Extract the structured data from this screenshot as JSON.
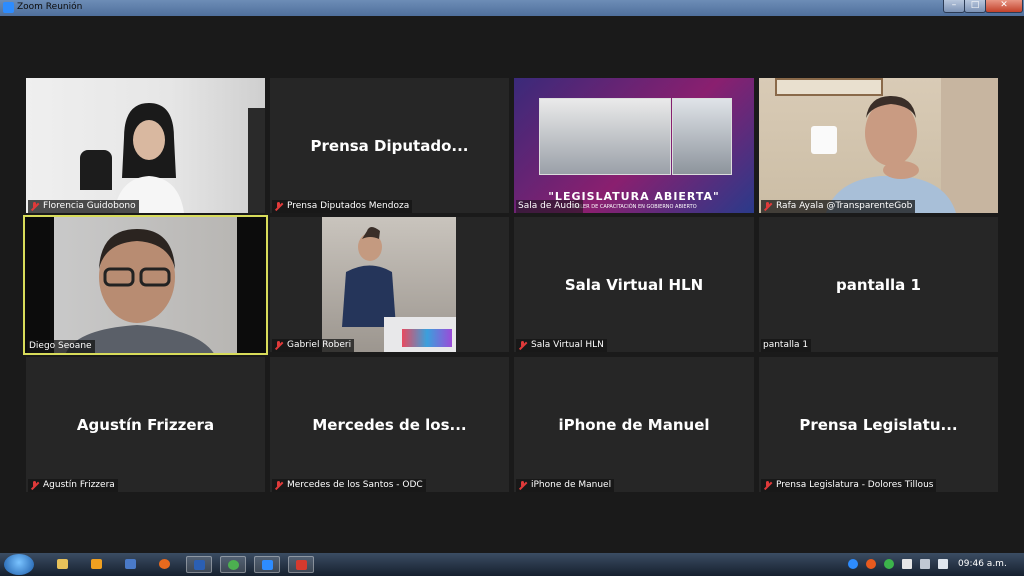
{
  "window": {
    "title": "Zoom Reunión"
  },
  "tiles": [
    {
      "name": "Florencia Guidobono",
      "big": ""
    },
    {
      "name": "Prensa Diputados Mendoza",
      "big": "Prensa Diputado..."
    },
    {
      "name": "Sala de Audio",
      "big": "",
      "banner": "\"LEGISLATURA ABIERTA\"",
      "banner_sub": "TALLER DE CAPACITACIÓN EN GOBIERNO ABIERTO"
    },
    {
      "name": "Rafa Ayala @TransparenteGob",
      "big": ""
    },
    {
      "name": "Diego Seoane",
      "big": ""
    },
    {
      "name": "Gabriel Roberi",
      "big": ""
    },
    {
      "name": "Sala Virtual HLN",
      "big": "Sala Virtual HLN"
    },
    {
      "name": "pantalla 1",
      "big": "pantalla 1"
    },
    {
      "name": "Agustín Frizzera",
      "big": "Agustín Frizzera"
    },
    {
      "name": "Mercedes de los Santos - ODC",
      "big": "Mercedes de los..."
    },
    {
      "name": "iPhone de Manuel",
      "big": "iPhone de Manuel"
    },
    {
      "name": "Prensa Legislatura - Dolores Tillous",
      "big": "Prensa Legislatu..."
    }
  ],
  "taskbar": {
    "clock": "09:46 a.m."
  },
  "colors": {
    "active_speaker_border": "#d8dc5a",
    "muted_mic": "#e03a3a",
    "tile_bg": "#262626"
  }
}
